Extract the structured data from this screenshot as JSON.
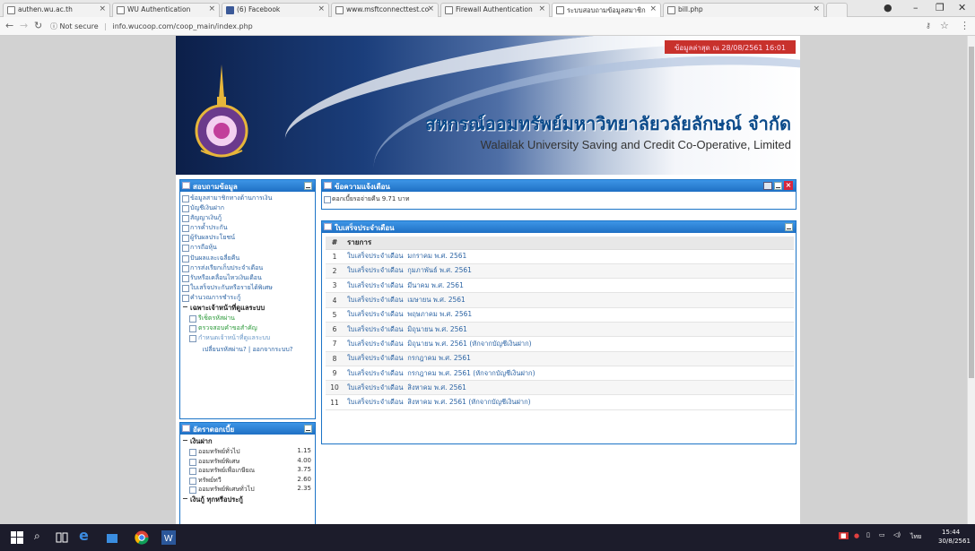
{
  "browser": {
    "tabs": [
      {
        "label": "authen.wu.ac.th",
        "favicon": "blank"
      },
      {
        "label": "WU Authentication",
        "favicon": "page"
      },
      {
        "label": "(6) Facebook",
        "favicon": "facebook"
      },
      {
        "label": "www.msftconnecttest.co",
        "favicon": "page"
      },
      {
        "label": "Firewall Authentication",
        "favicon": "page"
      },
      {
        "label": "ระบบสอบถามข้อมูลสมาชิก",
        "favicon": "page"
      },
      {
        "label": "bill.php",
        "favicon": "page"
      }
    ],
    "active_tab": 5,
    "url_security": "Not secure",
    "url": "info.wucoop.com/coop_main/index.php",
    "window_controls": [
      "account-icon",
      "minimize-icon",
      "restore-icon",
      "close-icon"
    ]
  },
  "banner": {
    "date_text": "ข้อมูลล่าสุด ณ 28/08/2561 16:01",
    "title_th": "สหกรณ์ออมทรัพย์มหาวิทยาลัยวลัยลักษณ์ จำกัด",
    "title_en": "Walailak University Saving and Credit Co-Operative, Limited",
    "logo_text": "มหาวิทยาลัยวลัยลักษณ์"
  },
  "menu_box": {
    "title": "สอบถามข้อมูล",
    "items": [
      "ข้อมูลสามาชิกทางด้านการเงิน",
      "บัญชีเงินฝาก",
      "สัญญาเงินกู้",
      "การค้ำประกัน",
      "ผู้รับผลประโยชน์",
      "การถือหุ้น",
      "ปันผลและเฉลี่ยคืน",
      "การส่งเรียกเก็บประจำเดือน",
      "รับหรือเคลื่อนไหวเงินเดือน",
      "ใบเสร็จประกันหรือรายได้พิเศษ",
      "คำนวณการชำระกู้"
    ],
    "section": "เฉพาะเจ้าหน้าที่ดูแลระบบ",
    "subitems": [
      "รีเซ็ตรหัสผ่าน",
      "ตรวจสอบคำขอสำคัญ",
      "กำหนดเจ้าหน้าที่ดูแลระบบ"
    ],
    "links": "เปลี่ยนรหัสผ่าน? | ออกจากระบบ?"
  },
  "rate_box": {
    "title": "อัตราดอกเบี้ย",
    "section1": "เงินฝาก",
    "rates": [
      {
        "label": "ออมทรัพย์ทั่วไป",
        "value": "1.15"
      },
      {
        "label": "ออมทรัพย์พิเศษ",
        "value": "4.00"
      },
      {
        "label": "ออมทรัพย์เพื่อเกษียณ",
        "value": "3.75"
      },
      {
        "label": "ทรัพย์ทวี",
        "value": "2.60"
      },
      {
        "label": "ออมทรัพย์พิเศษทั่วไป",
        "value": "2.35"
      }
    ],
    "section2": "เงินกู้ ทุกหรือประกู้"
  },
  "notice_box": {
    "title": "ข้อความแจ้งเตือน",
    "message": "ดอกเบี้ยรอจ่ายคืน 9.71 บาท"
  },
  "receipt_box": {
    "title": "ใบเสร็จประจำเดือน",
    "col_num": "#",
    "col_item": "รายการ",
    "rows": [
      {
        "n": "1",
        "label": "ใบเสร็จประจำเดือน",
        "month": "มกราคม พ.ศ. 2561"
      },
      {
        "n": "2",
        "label": "ใบเสร็จประจำเดือน",
        "month": "กุมภาพันธ์ พ.ศ. 2561"
      },
      {
        "n": "3",
        "label": "ใบเสร็จประจำเดือน",
        "month": "มีนาคม พ.ศ. 2561"
      },
      {
        "n": "4",
        "label": "ใบเสร็จประจำเดือน",
        "month": "เมษายน พ.ศ. 2561"
      },
      {
        "n": "5",
        "label": "ใบเสร็จประจำเดือน",
        "month": "พฤษภาคม พ.ศ. 2561"
      },
      {
        "n": "6",
        "label": "ใบเสร็จประจำเดือน",
        "month": "มิถุนายน พ.ศ. 2561"
      },
      {
        "n": "7",
        "label": "ใบเสร็จประจำเดือน",
        "month": "มิถุนายน พ.ศ. 2561 (หักจากบัญชีเงินฝาก)"
      },
      {
        "n": "8",
        "label": "ใบเสร็จประจำเดือน",
        "month": "กรกฎาคม พ.ศ. 2561"
      },
      {
        "n": "9",
        "label": "ใบเสร็จประจำเดือน",
        "month": "กรกฎาคม พ.ศ. 2561 (หักจากบัญชีเงินฝาก)"
      },
      {
        "n": "10",
        "label": "ใบเสร็จประจำเดือน",
        "month": "สิงหาคม พ.ศ. 2561"
      },
      {
        "n": "11",
        "label": "ใบเสร็จประจำเดือน",
        "month": "สิงหาคม พ.ศ. 2561 (หักจากบัญชีเงินฝาก)"
      }
    ]
  },
  "taskbar": {
    "lang": "ไทย",
    "time": "15:44",
    "date": "30/8/2561"
  }
}
